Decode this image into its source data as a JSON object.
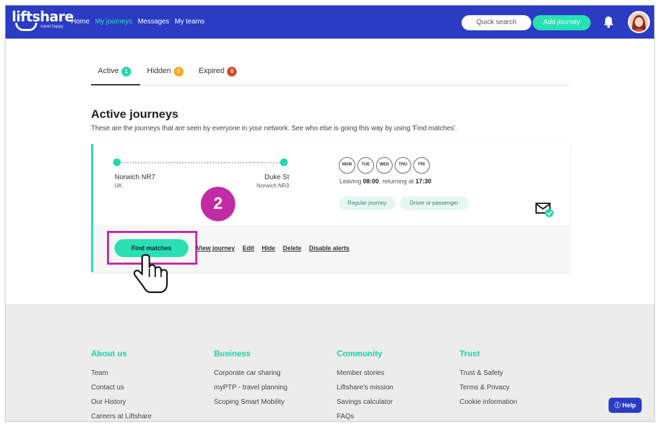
{
  "header": {
    "logo_text": "liftshare",
    "logo_tagline": "travel happy",
    "nav": [
      "Home",
      "My journeys",
      "Messages",
      "My teams"
    ],
    "quick_search": "Quick search",
    "add_journey": "Add journey"
  },
  "tabs": [
    {
      "label": "Active",
      "count": "1",
      "color": "#1ed9ad"
    },
    {
      "label": "Hidden",
      "count": "0",
      "color": "#f5a623"
    },
    {
      "label": "Expired",
      "count": "0",
      "color": "#d6452c"
    }
  ],
  "section": {
    "title": "Active journeys",
    "description": "These are the journeys that are seen by everyone in your network. See who else is going this way by using 'Find matches'."
  },
  "journey": {
    "from_name": "Norwich NR7",
    "from_sub": "UK",
    "to_name": "Duke St",
    "to_sub": "Norwich NR3",
    "days": [
      "MON",
      "TUE",
      "WED",
      "THU",
      "FRI"
    ],
    "leaving_prefix": "Leaving ",
    "leaving_time": "08:00",
    "returning_prefix": ", returning at ",
    "returning_time": "17:30",
    "chips": [
      "Regular journey",
      "Driver or passenger"
    ],
    "find_matches": "Find matches",
    "actions": [
      "View journey",
      "Edit",
      "Hide",
      "Delete",
      "Disable alerts"
    ]
  },
  "step_number": "2",
  "footer": {
    "columns": [
      {
        "title": "About us",
        "items": [
          "Team",
          "Contact us",
          "Our History",
          "Careers at Liftshare"
        ]
      },
      {
        "title": "Business",
        "items": [
          "Corporate car sharing",
          "myPTP - travel planning",
          "Scoping Smart Mobility"
        ]
      },
      {
        "title": "Community",
        "items": [
          "Member stories",
          "Liftshare's mission",
          "Savings calculator",
          "FAQs"
        ]
      },
      {
        "title": "Trust",
        "items": [
          "Trust & Safety",
          "Terms & Privacy",
          "Cookie information"
        ]
      }
    ],
    "help": "Help"
  },
  "colors": {
    "brand": "#2a3cc4",
    "accent": "#28e0b4",
    "highlight": "#c22aa6"
  }
}
